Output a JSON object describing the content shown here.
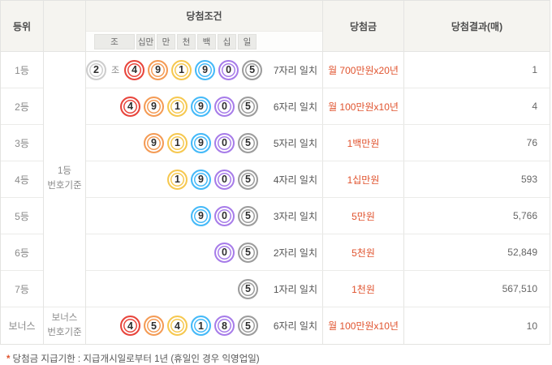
{
  "colors": {
    "accent": "#e0532e",
    "header_bg": "#f5f4f0",
    "border": "#e4e4e2",
    "ball_palette": {
      "jo": "#cdcdcd",
      "red": "#e8453c",
      "orange": "#f49b55",
      "yellow": "#f6c850",
      "blue": "#44b9f8",
      "purple": "#a77ce9",
      "gray": "#9c9c9c"
    }
  },
  "table": {
    "header": {
      "rank": "등위",
      "condition": "당첨조건",
      "prize": "당첨금",
      "result": "당첨결과(매)",
      "units": [
        "조",
        "십만",
        "만",
        "천",
        "백",
        "십",
        "일"
      ]
    },
    "group": {
      "first": [
        "1등",
        "번호기준"
      ],
      "bonus": [
        "보너스",
        "번호기준"
      ]
    },
    "rows": [
      {
        "rank": "1등",
        "balls": [
          {
            "n": "2",
            "c": "jo"
          },
          {
            "sep": "조"
          },
          {
            "n": "4",
            "c": "red"
          },
          {
            "n": "9",
            "c": "orange"
          },
          {
            "n": "1",
            "c": "yellow"
          },
          {
            "n": "9",
            "c": "blue"
          },
          {
            "n": "0",
            "c": "purple"
          },
          {
            "n": "5",
            "c": "gray"
          }
        ],
        "match": "7자리 일치",
        "prize": "월 700만원x20년",
        "result": "1"
      },
      {
        "rank": "2등",
        "balls": [
          {
            "n": "4",
            "c": "red"
          },
          {
            "n": "9",
            "c": "orange"
          },
          {
            "n": "1",
            "c": "yellow"
          },
          {
            "n": "9",
            "c": "blue"
          },
          {
            "n": "0",
            "c": "purple"
          },
          {
            "n": "5",
            "c": "gray"
          }
        ],
        "match": "6자리 일치",
        "prize": "월 100만원x10년",
        "result": "4"
      },
      {
        "rank": "3등",
        "balls": [
          {
            "n": "9",
            "c": "orange"
          },
          {
            "n": "1",
            "c": "yellow"
          },
          {
            "n": "9",
            "c": "blue"
          },
          {
            "n": "0",
            "c": "purple"
          },
          {
            "n": "5",
            "c": "gray"
          }
        ],
        "match": "5자리 일치",
        "prize": "1백만원",
        "result": "76"
      },
      {
        "rank": "4등",
        "balls": [
          {
            "n": "1",
            "c": "yellow"
          },
          {
            "n": "9",
            "c": "blue"
          },
          {
            "n": "0",
            "c": "purple"
          },
          {
            "n": "5",
            "c": "gray"
          }
        ],
        "match": "4자리 일치",
        "prize": "1십만원",
        "result": "593"
      },
      {
        "rank": "5등",
        "balls": [
          {
            "n": "9",
            "c": "blue"
          },
          {
            "n": "0",
            "c": "purple"
          },
          {
            "n": "5",
            "c": "gray"
          }
        ],
        "match": "3자리 일치",
        "prize": "5만원",
        "result": "5,766"
      },
      {
        "rank": "6등",
        "balls": [
          {
            "n": "0",
            "c": "purple"
          },
          {
            "n": "5",
            "c": "gray"
          }
        ],
        "match": "2자리 일치",
        "prize": "5천원",
        "result": "52,849"
      },
      {
        "rank": "7등",
        "balls": [
          {
            "n": "5",
            "c": "gray"
          }
        ],
        "match": "1자리 일치",
        "prize": "1천원",
        "result": "567,510"
      },
      {
        "rank": "보너스",
        "balls": [
          {
            "n": "4",
            "c": "red"
          },
          {
            "n": "5",
            "c": "orange"
          },
          {
            "n": "4",
            "c": "yellow"
          },
          {
            "n": "1",
            "c": "blue"
          },
          {
            "n": "8",
            "c": "purple"
          },
          {
            "n": "5",
            "c": "gray"
          }
        ],
        "match": "6자리 일치",
        "prize": "월 100만원x10년",
        "result": "10"
      }
    ],
    "footer": {
      "marker": "*",
      "text": "당첨금 지급기한 : 지급개시일로부터 1년 (휴일인 경우 익영업일)"
    }
  }
}
